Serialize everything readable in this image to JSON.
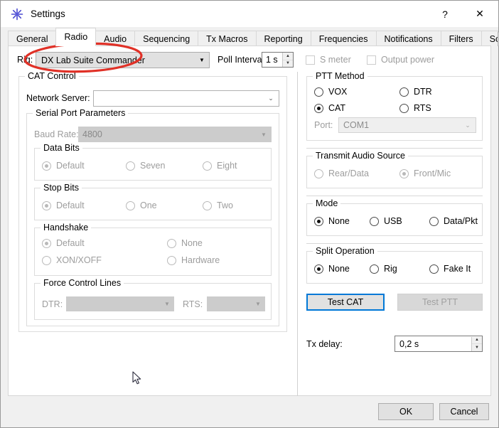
{
  "window": {
    "title": "Settings",
    "app_icon": "starburst-icon",
    "help_label": "?",
    "close_label": "✕"
  },
  "tabs": {
    "items": [
      {
        "label": "General",
        "active": false
      },
      {
        "label": "Radio",
        "active": true
      },
      {
        "label": "Audio",
        "active": false
      },
      {
        "label": "Sequencing",
        "active": false
      },
      {
        "label": "Tx Macros",
        "active": false
      },
      {
        "label": "Reporting",
        "active": false
      },
      {
        "label": "Frequencies",
        "active": false
      },
      {
        "label": "Notifications",
        "active": false
      },
      {
        "label": "Filters",
        "active": false
      },
      {
        "label": "Schedu",
        "active": false
      }
    ],
    "scroll_left": "◀",
    "scroll_right": "▶"
  },
  "toprow": {
    "rig_label": "Rig:",
    "rig_value": "DX Lab Suite Commander",
    "rig_arrow": "▼",
    "poll_label": "Poll Interval:",
    "poll_value": "1 s",
    "spin_up": "▲",
    "spin_down": "▼",
    "smeter_label": "S meter",
    "smeter_checked": false,
    "outpower_label": "Output power",
    "outpower_checked": false
  },
  "cat_control": {
    "title": "CAT Control",
    "network_server_label": "Network Server:",
    "network_server_value": "",
    "network_server_arrow": "⌄",
    "serial": {
      "title": "Serial Port Parameters",
      "baud_label": "Baud Rate:",
      "baud_value": "4800",
      "baud_arrow": "▼",
      "data_bits": {
        "title": "Data Bits",
        "options": [
          {
            "label": "Default",
            "selected": true
          },
          {
            "label": "Seven",
            "selected": false
          },
          {
            "label": "Eight",
            "selected": false
          }
        ]
      },
      "stop_bits": {
        "title": "Stop Bits",
        "options": [
          {
            "label": "Default",
            "selected": true
          },
          {
            "label": "One",
            "selected": false
          },
          {
            "label": "Two",
            "selected": false
          }
        ]
      },
      "handshake": {
        "title": "Handshake",
        "options": [
          {
            "label": "Default",
            "selected": true
          },
          {
            "label": "None",
            "selected": false
          },
          {
            "label": "XON/XOFF",
            "selected": false
          },
          {
            "label": "Hardware",
            "selected": false
          }
        ]
      },
      "force_control_lines": {
        "title": "Force Control Lines",
        "dtr_label": "DTR:",
        "dtr_value": "",
        "rts_label": "RTS:",
        "rts_value": "",
        "arrow": "▼"
      }
    }
  },
  "ptt_method": {
    "title": "PTT Method",
    "options": [
      {
        "label": "VOX",
        "selected": false
      },
      {
        "label": "DTR",
        "selected": false
      },
      {
        "label": "CAT",
        "selected": true
      },
      {
        "label": "RTS",
        "selected": false
      }
    ],
    "port_label": "Port:",
    "port_value": "COM1",
    "port_arrow": "⌄"
  },
  "transmit_audio_source": {
    "title": "Transmit Audio Source",
    "options": [
      {
        "label": "Rear/Data",
        "selected": false
      },
      {
        "label": "Front/Mic",
        "selected": true
      }
    ]
  },
  "mode": {
    "title": "Mode",
    "options": [
      {
        "label": "None",
        "selected": true
      },
      {
        "label": "USB",
        "selected": false
      },
      {
        "label": "Data/Pkt",
        "selected": false
      }
    ]
  },
  "split_operation": {
    "title": "Split Operation",
    "options": [
      {
        "label": "None",
        "selected": true
      },
      {
        "label": "Rig",
        "selected": false
      },
      {
        "label": "Fake It",
        "selected": false
      }
    ]
  },
  "actions": {
    "test_cat_label": "Test CAT",
    "test_ptt_label": "Test PTT",
    "tx_delay_label": "Tx delay:",
    "tx_delay_value": "0,2 s",
    "ok_label": "OK",
    "cancel_label": "Cancel"
  },
  "annotation": {
    "shape": "red-ellipse-highlight",
    "color": "#e03127",
    "target": "rig-combo"
  }
}
